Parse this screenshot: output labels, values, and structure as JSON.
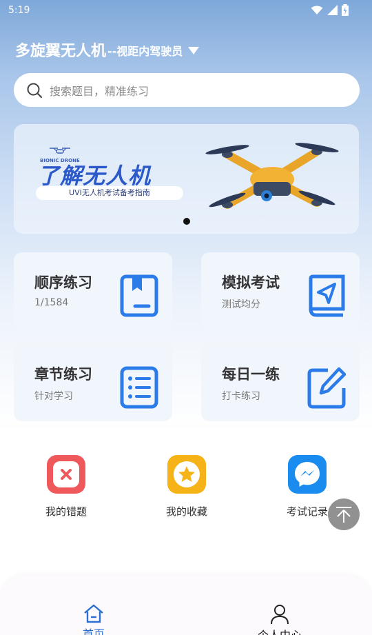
{
  "status_bar": {
    "time": "5:19",
    "icons": [
      "wifi-icon",
      "signal-icon",
      "battery-charging-icon"
    ]
  },
  "header": {
    "title": "多旋翼无人机",
    "subtitle": "--视距内驾驶员",
    "dropdown_icon": "caret-down-icon"
  },
  "search": {
    "placeholder": "搜索题目，精准练习",
    "icon": "search-icon"
  },
  "banner": {
    "brand": "BIONIC DRONE",
    "title": "了解无人机",
    "subtitle": "UVI无人机考试备考指南",
    "active_slide": 1,
    "slide_count": 1
  },
  "practice_cards": [
    {
      "title": "顺序练习",
      "sub": "1/1584",
      "icon": "book-icon"
    },
    {
      "title": "模拟考试",
      "sub": "测试均分",
      "icon": "send-book-icon"
    },
    {
      "title": "章节练习",
      "sub": "针对学习",
      "icon": "list-icon"
    },
    {
      "title": "每日一练",
      "sub": "打卡练习",
      "icon": "edit-icon"
    }
  ],
  "quick_links": [
    {
      "label": "我的错题",
      "icon": "wrong-questions-icon",
      "color": "#f0595c"
    },
    {
      "label": "我的收藏",
      "icon": "star-icon",
      "color": "#f5b318"
    },
    {
      "label": "考试记录",
      "icon": "messenger-icon",
      "color": "#1a8cf0"
    }
  ],
  "back_to_top": {
    "icon": "arrow-up-to-top-icon"
  },
  "tabs": [
    {
      "label": "首页",
      "icon": "home-icon",
      "active": true
    },
    {
      "label": "个人中心",
      "icon": "user-icon",
      "active": false
    }
  ],
  "colors": {
    "accent": "#2b7ce9",
    "card_bg": "#f1f6fd",
    "tab_active": "#2b6fd1"
  }
}
